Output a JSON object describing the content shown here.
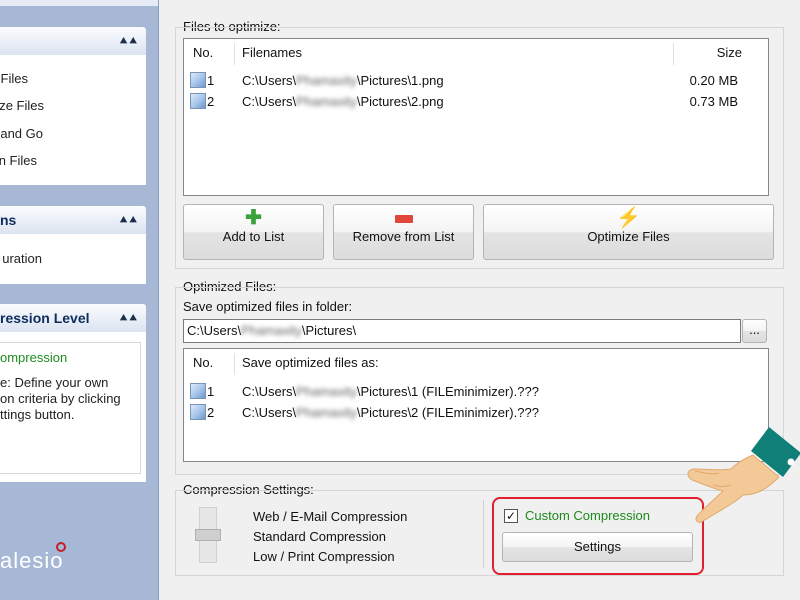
{
  "sidebar": {
    "sections": [
      {
        "title": "",
        "items": [
          "Files",
          "ze Files",
          "and Go",
          "n Files"
        ]
      },
      {
        "title": "ns",
        "items": [
          "uration"
        ]
      },
      {
        "title": "ression Level",
        "selected": "ompression",
        "description": [
          "e: Define your own",
          "on criteria by clicking",
          "ttings button."
        ]
      }
    ],
    "logo_text": "alesio"
  },
  "files_to_optimize": {
    "group_label": "Files to optimize:",
    "columns": {
      "no": "No.",
      "filenames": "Filenames",
      "size": "Size"
    },
    "rows": [
      {
        "no": "1",
        "path_prefix": "C:\\Users\\",
        "path_blur": "Phamaxity",
        "path_suffix": "\\Pictures\\1.png",
        "size": "0.20 MB"
      },
      {
        "no": "2",
        "path_prefix": "C:\\Users\\",
        "path_blur": "Phamaxity",
        "path_suffix": "\\Pictures\\2.png",
        "size": "0.73 MB"
      }
    ],
    "buttons": {
      "add": "Add to List",
      "remove": "Remove from List",
      "optimize": "Optimize Files"
    }
  },
  "optimized_files": {
    "group_label": "Optimized Files:",
    "folder_label": "Save optimized files in folder:",
    "folder_prefix": "C:\\Users\\",
    "folder_blur": "Phamaxity",
    "folder_suffix": "\\Pictures\\",
    "browse_label": "...",
    "columns": {
      "no": "No.",
      "save_as": "Save optimized files as:"
    },
    "rows": [
      {
        "no": "1",
        "path_prefix": "C:\\Users\\",
        "path_blur": "Phamaxity",
        "path_suffix": "\\Pictures\\1 (FILEminimizer).???"
      },
      {
        "no": "2",
        "path_prefix": "C:\\Users\\",
        "path_blur": "Phamaxity",
        "path_suffix": "\\Pictures\\2 (FILEminimizer).???"
      }
    ]
  },
  "compression_settings": {
    "group_label": "Compression Settings:",
    "levels": [
      "Web / E-Mail Compression",
      "Standard Compression",
      "Low / Print Compression"
    ],
    "custom_label": "Custom Compression",
    "custom_checked": true,
    "settings_button": "Settings"
  },
  "colors": {
    "sidebar_bg": "#a7b8d6",
    "custom_green": "#1e8a1e",
    "highlight_red": "#e01f2f",
    "add_green": "#3aa23a",
    "remove_red": "#e0473a",
    "optimize_yellow": "#f2b705"
  },
  "icons": {
    "image_file": "image-file-icon",
    "add": "plus-icon",
    "remove": "minus-icon",
    "optimize": "lightning-icon",
    "collapse": "double-chevron-up-icon"
  }
}
